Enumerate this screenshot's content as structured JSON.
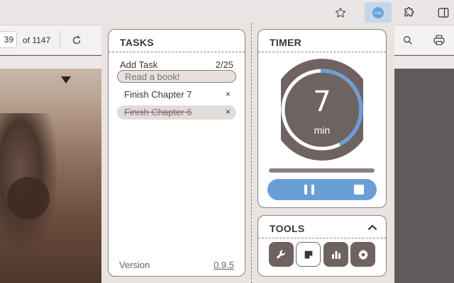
{
  "browser": {
    "page_current": "39",
    "page_of": "of 1147",
    "extension_badge": "0:00"
  },
  "tasks": {
    "title": "TASKS",
    "add_task_label": "Add Task",
    "task_count": "2/25",
    "input_placeholder": "Read a book!",
    "items": [
      {
        "text": "Finish Chapter 7",
        "done": false
      },
      {
        "text": "Finish Chapter 6",
        "done": true
      }
    ],
    "remove_symbol": "×",
    "version_label": "Version",
    "version_number": "0.9.5"
  },
  "timer": {
    "title": "TIMER",
    "minutes": "7",
    "unit": "min",
    "ring_fraction": 0.42,
    "progress_fraction": 0.0
  },
  "tools": {
    "title": "TOOLS",
    "buttons": [
      "wrench-icon",
      "sticky-note-icon",
      "bar-chart-icon",
      "gear-icon"
    ],
    "selected": "sticky-note-icon"
  },
  "colors": {
    "accent": "#6a9fd6",
    "dark": "#6e6361",
    "border": "#8b807c",
    "popup_bg": "#e9e4e1"
  }
}
